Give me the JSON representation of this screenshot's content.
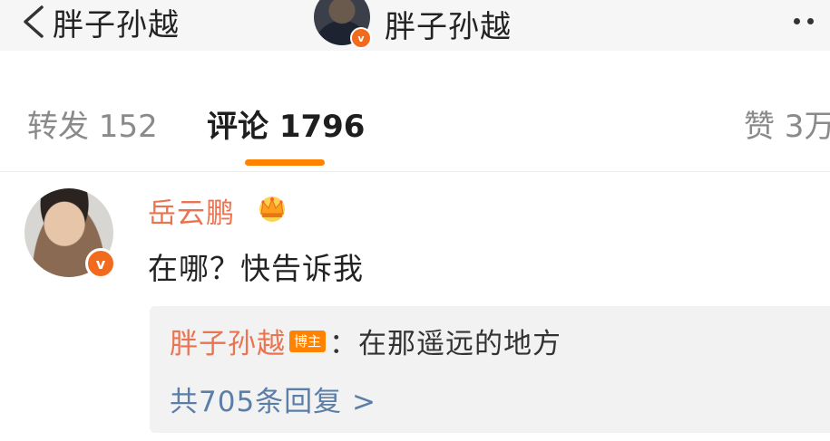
{
  "navbar": {
    "back_label": "胖子孙越",
    "title": "胖子孙越",
    "verified_badge": "v",
    "more_icon": "more-dots-icon"
  },
  "tabs": {
    "repost": "转发 152",
    "comment": "评论 1796",
    "like": "赞 3万"
  },
  "comment": {
    "author": "岳云鹏",
    "verified_badge": "v",
    "crown_icon": "crown-icon",
    "text": "在哪？快告诉我",
    "reply": {
      "author": "胖子孙越",
      "badge": "博主",
      "text": "：在那遥远的地方",
      "more": "共705条回复 >"
    }
  },
  "colors": {
    "accent": "#ff8200",
    "name_color": "#eb7350",
    "link_color": "#5b7ea8"
  }
}
